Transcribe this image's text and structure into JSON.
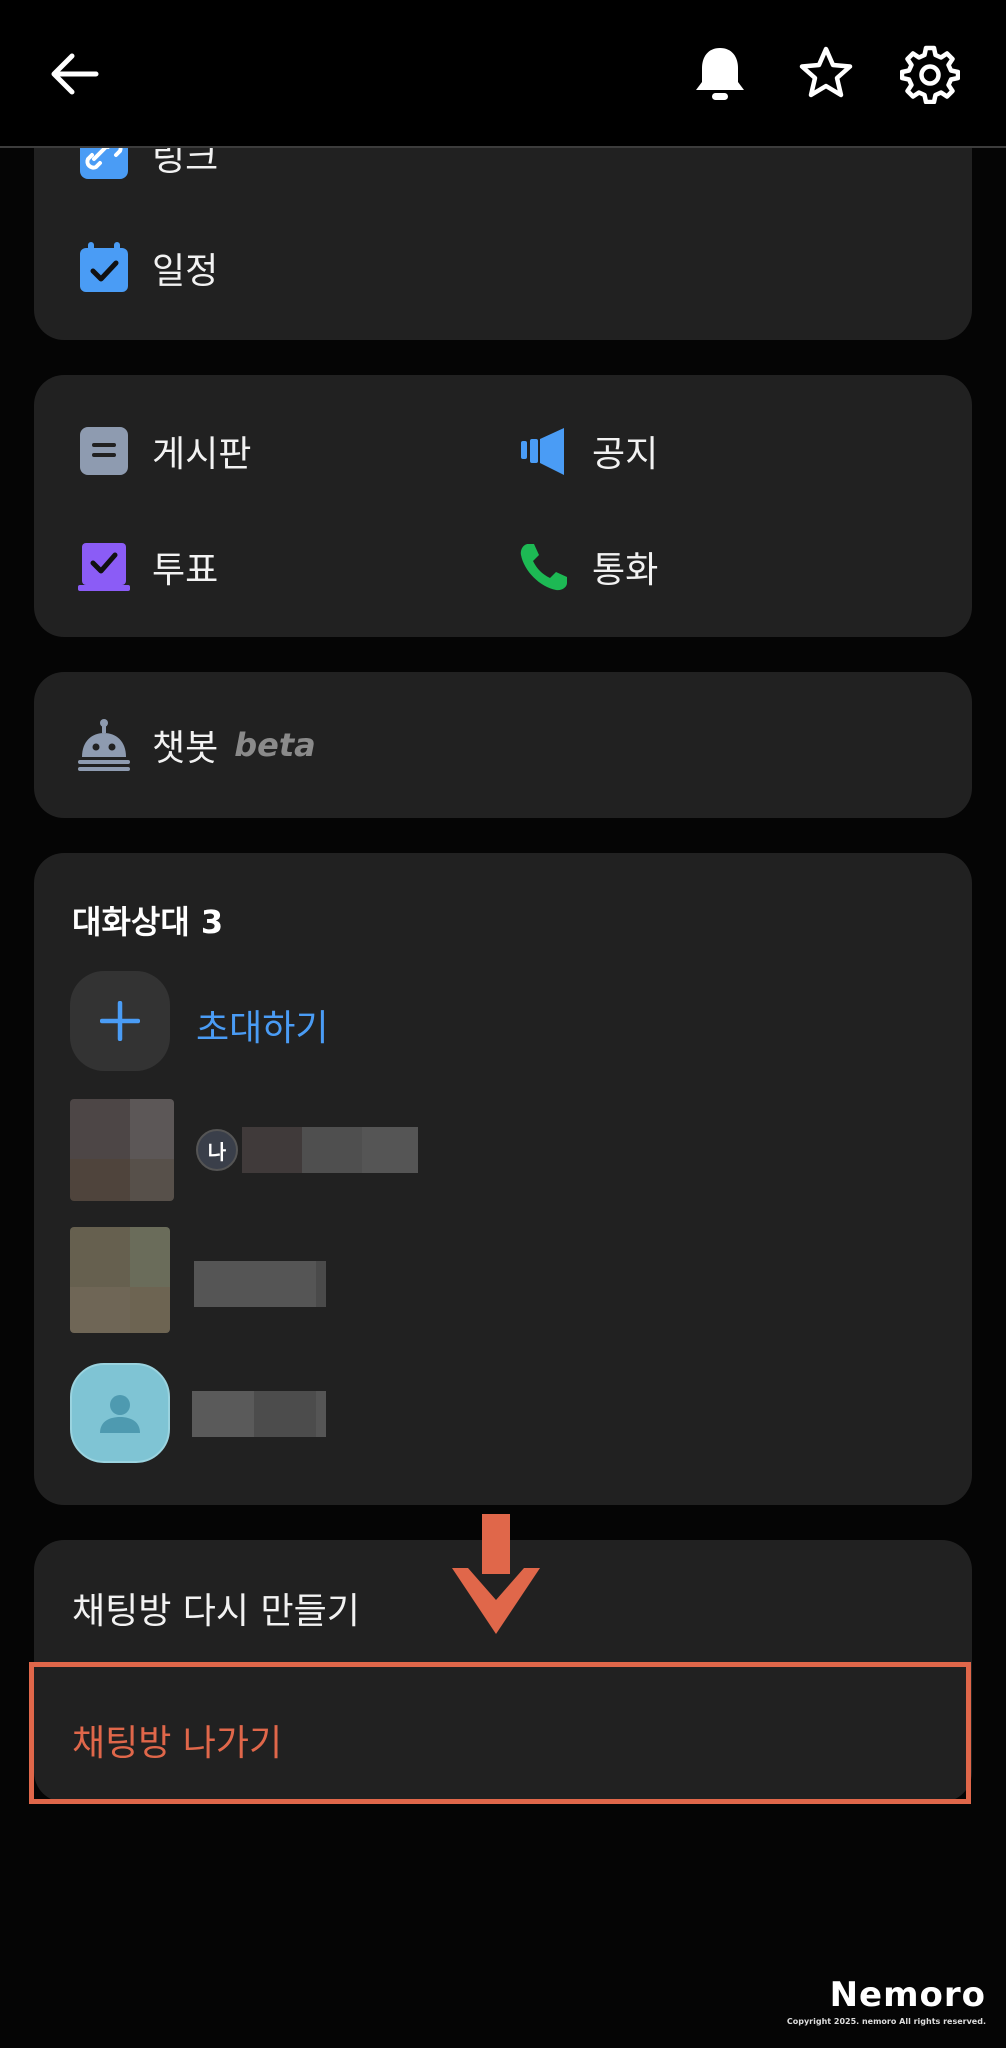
{
  "menu_top": {
    "link_label": "링크",
    "schedule_label": "일정"
  },
  "features": {
    "board": "게시판",
    "notice": "공지",
    "vote": "투표",
    "call": "통화"
  },
  "chatbot": {
    "label": "챗봇",
    "badge": "beta"
  },
  "members": {
    "title": "대화상대 3",
    "invite_label": "초대하기",
    "me_badge": "나"
  },
  "actions": {
    "recreate": "채팅방 다시 만들기",
    "leave": "채팅방 나가기"
  },
  "brand": {
    "name": "Nemoro",
    "copyright": "Copyright 2025. nemoro All rights reserved."
  },
  "colors": {
    "accent_blue": "#4a9cf5",
    "highlight": "#e0674a",
    "call_green": "#1db954",
    "vote_purple": "#8b5cf6"
  },
  "icons": [
    "back-arrow-icon",
    "bell-icon",
    "star-icon",
    "gear-icon",
    "link-icon",
    "calendar-icon",
    "board-icon",
    "megaphone-icon",
    "vote-icon",
    "phone-icon",
    "robot-icon",
    "plus-icon",
    "person-icon"
  ]
}
